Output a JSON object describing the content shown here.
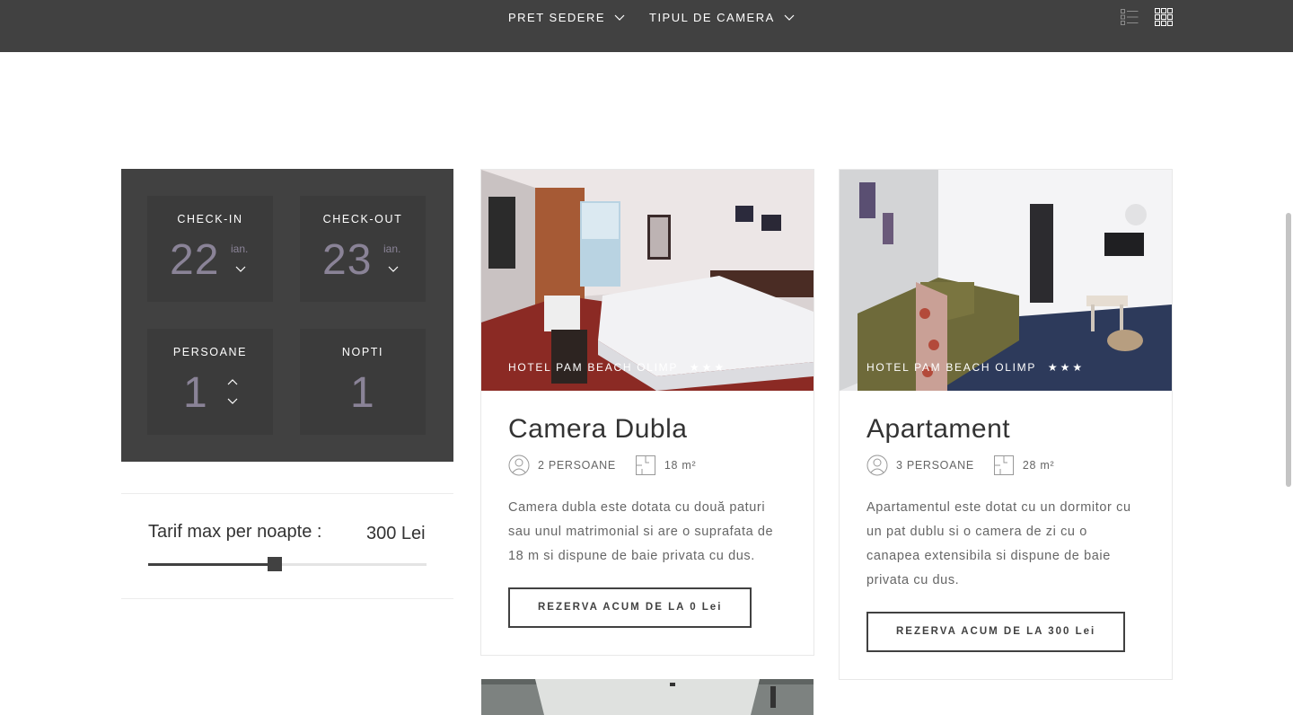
{
  "topbar": {
    "filters": [
      {
        "label": "PRET SEDERE"
      },
      {
        "label": "TIPUL DE CAMERA"
      }
    ],
    "view_icons": [
      "list-view-icon",
      "grid-view-icon"
    ]
  },
  "booking": {
    "checkin": {
      "label": "CHECK-IN",
      "day": "22",
      "month": "ian."
    },
    "checkout": {
      "label": "CHECK-OUT",
      "day": "23",
      "month": "ian."
    },
    "persons": {
      "label": "PERSOANE",
      "value": "1"
    },
    "nights": {
      "label": "NOPTI",
      "value": "1"
    }
  },
  "price_filter": {
    "label": "Tarif max per noapte :",
    "value": "300 Lei",
    "slider_fraction": 0.455
  },
  "rooms": [
    {
      "hotel": "HOTEL PAM BEACH OLIMP",
      "stars": "★★★",
      "title": "Camera Dubla",
      "persons": "2 PERSOANE",
      "area": "18 m²",
      "description": "Camera dubla este dotata cu două paturi sau unul matrimonial si are o suprafata de 18 m si dispune de baie privata cu dus.",
      "button": "REZERVA ACUM DE LA 0 Lei"
    },
    {
      "hotel": "HOTEL PAM BEACH OLIMP",
      "stars": "★★★",
      "title": "Apartament",
      "persons": "3 PERSOANE",
      "area": "28 m²",
      "description": "Apartamentul este dotat cu un dormitor cu un pat dublu si o camera de zi cu o canapea extensibila si dispune de baie privata cu dus.",
      "button": "REZERVA ACUM DE LA 300 Lei"
    }
  ],
  "colors": {
    "panel": "#414141",
    "panel_cell": "#3b3b3b",
    "muted_number": "#8a8397"
  }
}
